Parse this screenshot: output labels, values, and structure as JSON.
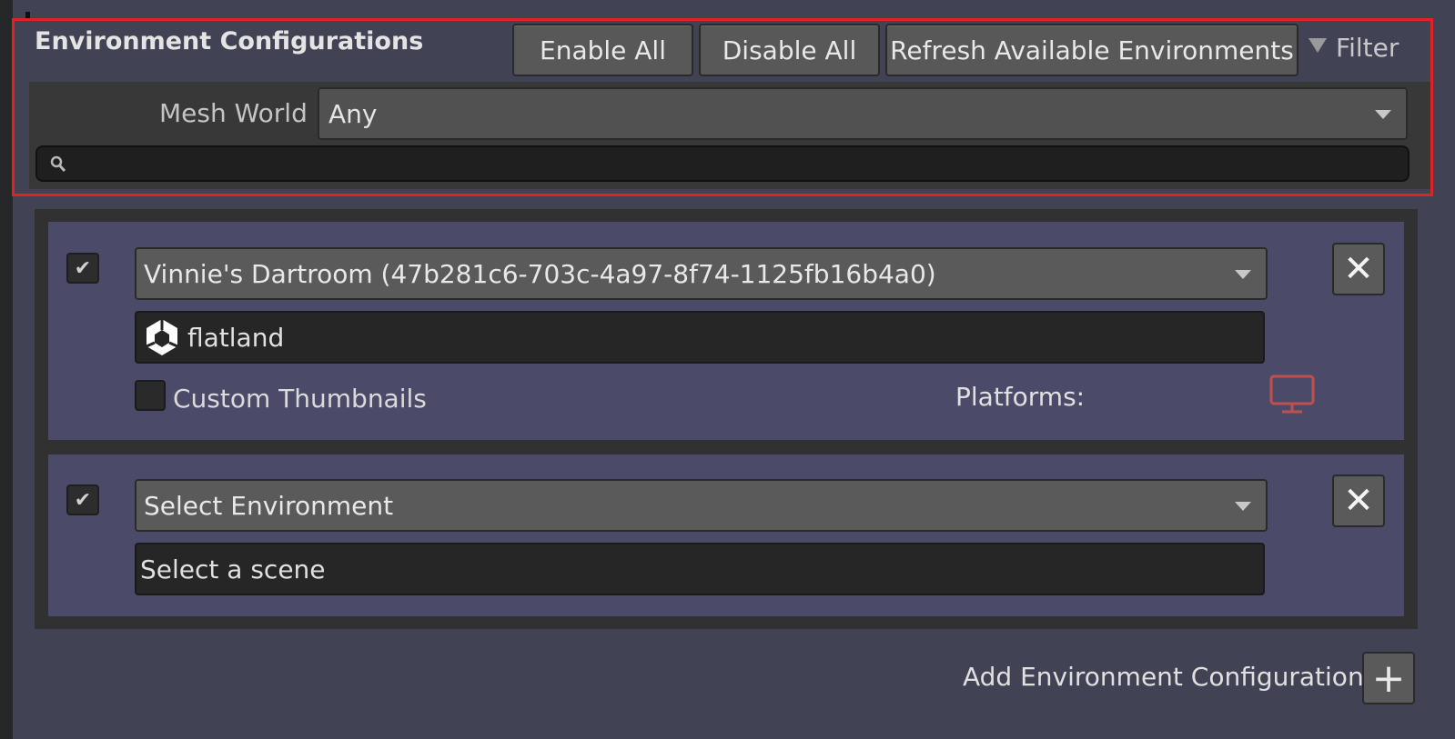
{
  "header": {
    "title": "Environment Configurations",
    "enable_all": "Enable All",
    "disable_all": "Disable All",
    "refresh": "Refresh Available Environments",
    "filter": "Filter"
  },
  "filter_area": {
    "mesh_world_label": "Mesh World",
    "mesh_world_value": "Any",
    "search_value": ""
  },
  "entries": [
    {
      "checked": true,
      "environment": "Vinnie's Dartroom (47b281c6-703c-4a97-8f74-1125fb16b4a0)",
      "scene": "flatland",
      "custom_thumbnails_label": "Custom Thumbnails",
      "platforms_label": "Platforms:",
      "platform_icon": "monitor-icon"
    },
    {
      "checked": true,
      "environment": "Select Environment",
      "scene": "Select a scene"
    }
  ],
  "footer": {
    "add_label": "Add Environment Configuration",
    "add_button": "+"
  },
  "colors": {
    "highlight": "#e0202a",
    "platform_icon": "#c0504d",
    "entry_bg": "#4b4b69"
  }
}
